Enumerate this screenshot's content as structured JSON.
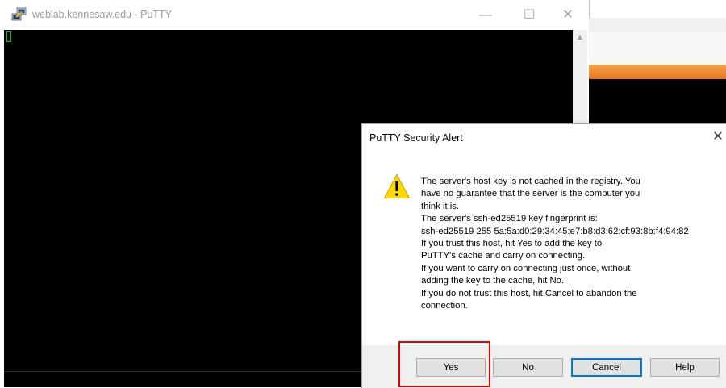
{
  "putty": {
    "title": "weblab.kennesaw.edu - PuTTY",
    "minimize_glyph": "—",
    "maximize_glyph": "☐",
    "close_glyph": "✕",
    "scroll_up_glyph": "▲"
  },
  "dialog": {
    "title": "PuTTY Security Alert",
    "close_glyph": "✕",
    "message_lines": [
      "The server's host key is not cached in the registry. You",
      "have no guarantee that the server is the computer you",
      "think it is.",
      "The server's ssh-ed25519 key fingerprint is:",
      "ssh-ed25519 255 5a:5a:d0:29:34:45:e7:b8:d3:62:cf:93:8b:f4:94:82",
      "If you trust this host, hit Yes to add the key to",
      "PuTTY's cache and carry on connecting.",
      "If you want to carry on connecting just once, without",
      "adding the key to the cache, hit No.",
      "If you do not trust this host, hit Cancel to abandon the",
      "connection."
    ],
    "buttons": {
      "yes": "Yes",
      "no": "No",
      "cancel": "Cancel",
      "help": "Help"
    }
  },
  "colors": {
    "terminal_bg": "#000000",
    "cursor": "#00cc00",
    "warning_yellow": "#ffd800",
    "highlight_red": "#e00000",
    "default_button_border": "#0078d7",
    "orange_titlebar": "#e8771b"
  },
  "icons": {
    "app_icon": "putty-icon",
    "warning": "warning-icon"
  }
}
